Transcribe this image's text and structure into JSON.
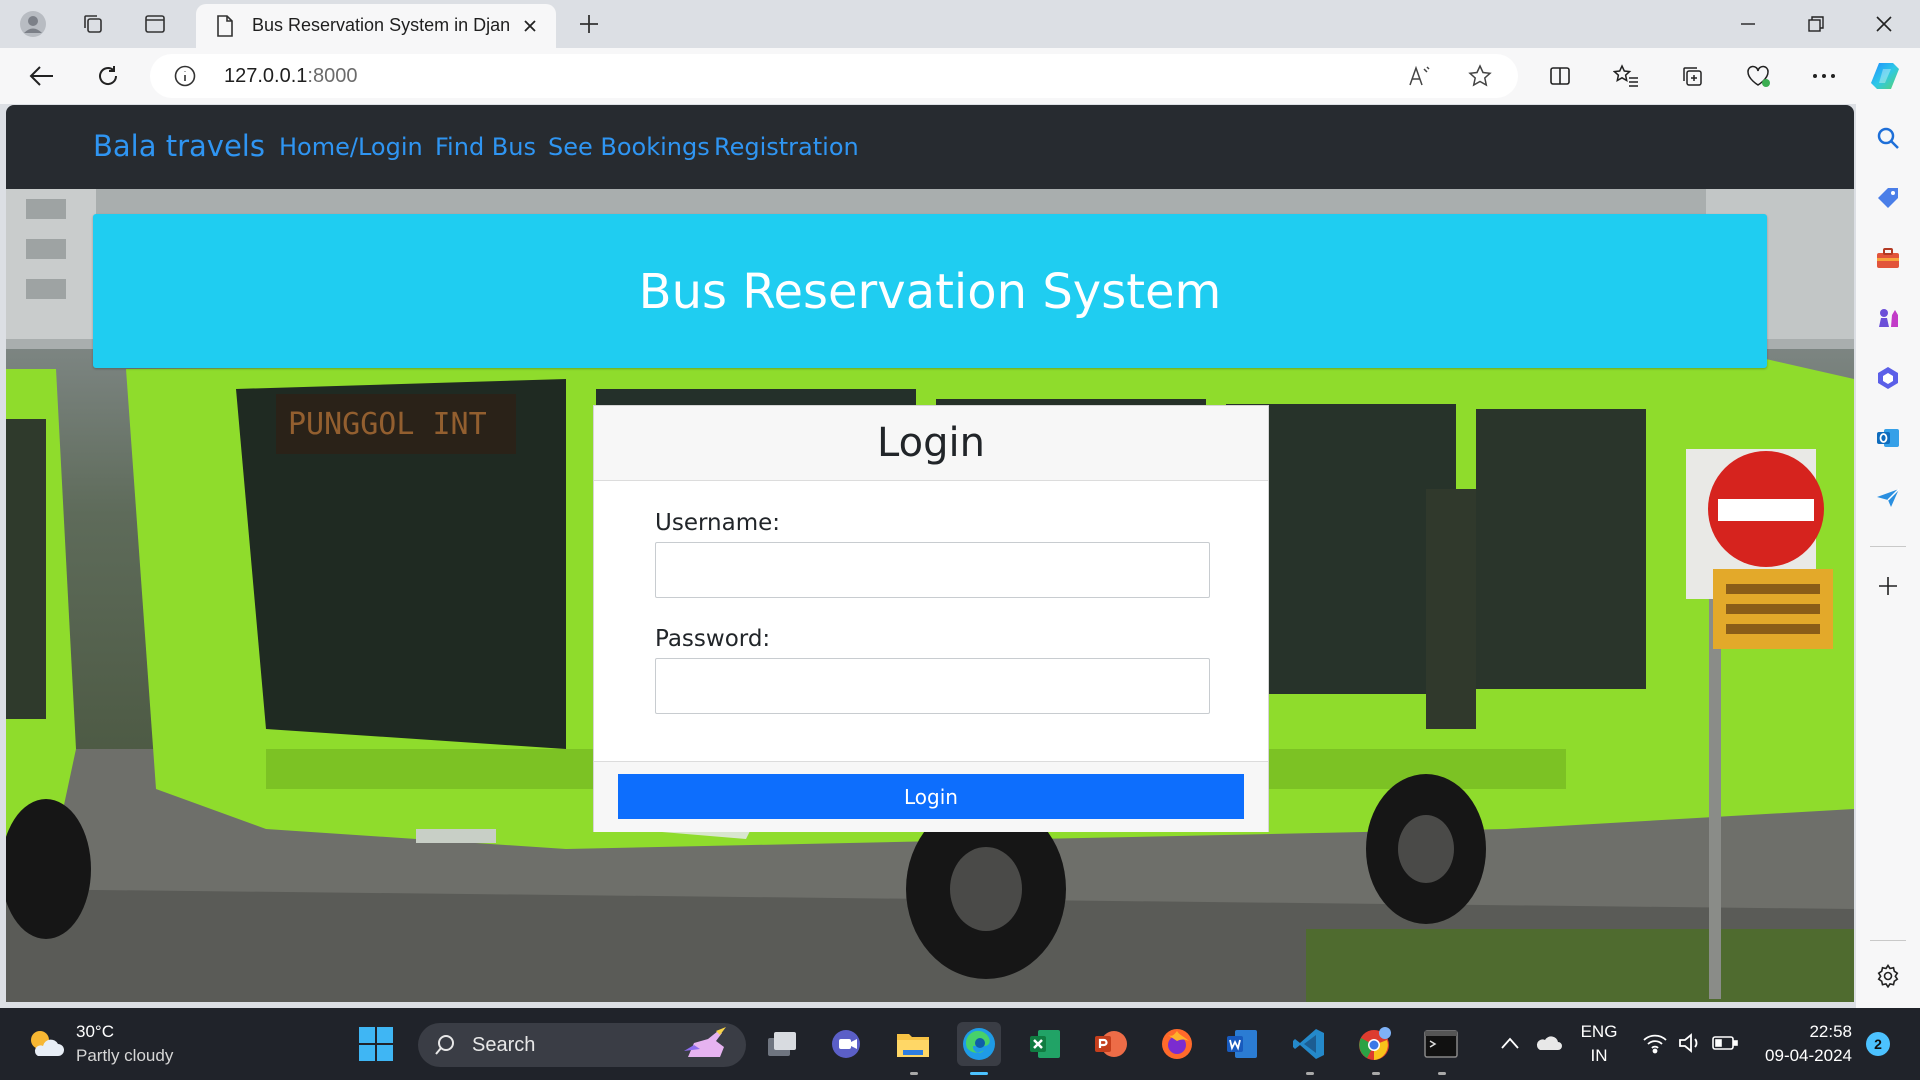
{
  "browser": {
    "tab_title": "Bus Reservation System in Django",
    "address_host": "127.0.0.1",
    "address_port": ":8000"
  },
  "navbar": {
    "brand": "Bala travels",
    "links": [
      "Home/Login",
      "Find Bus",
      "See Bookings",
      "Registration"
    ]
  },
  "page": {
    "heading": "Bus Reservation System",
    "login_title": "Login",
    "username_label": "Username:",
    "password_label": "Password:",
    "login_button": "Login"
  },
  "taskbar": {
    "temperature": "30°C",
    "weather": "Partly cloudy",
    "search": "Search",
    "language": "ENG",
    "region": "IN",
    "time": "22:58",
    "date": "09-04-2024",
    "notification_count": "2"
  },
  "colors": {
    "navbar_bg": "#272b30",
    "nav_link": "#2f95f2",
    "jumbotron": "#1fcdf1",
    "primary_button": "#0d6efd",
    "bus_green": "#8fdc2c"
  }
}
